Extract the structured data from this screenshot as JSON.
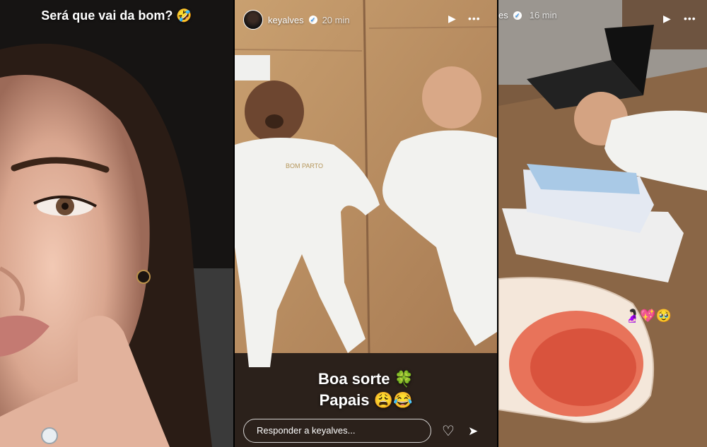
{
  "panel1": {
    "caption": "Será que vai da bom? 🤣"
  },
  "panel2": {
    "username": "keyalves",
    "time": "20 min",
    "caption_line1": "Boa sorte 🍀",
    "caption_line2": "Papais 😩😂",
    "reply_placeholder": "Responder a keyalves...",
    "embroidery": "BOM PARTO"
  },
  "panel3": {
    "username_fragment": "es",
    "time": "16 min",
    "stickers": "🤰🏻💖🥹"
  },
  "icons": {
    "verified": "✓",
    "play": "▶",
    "more": "•••",
    "heart": "♡",
    "send": "➤"
  }
}
